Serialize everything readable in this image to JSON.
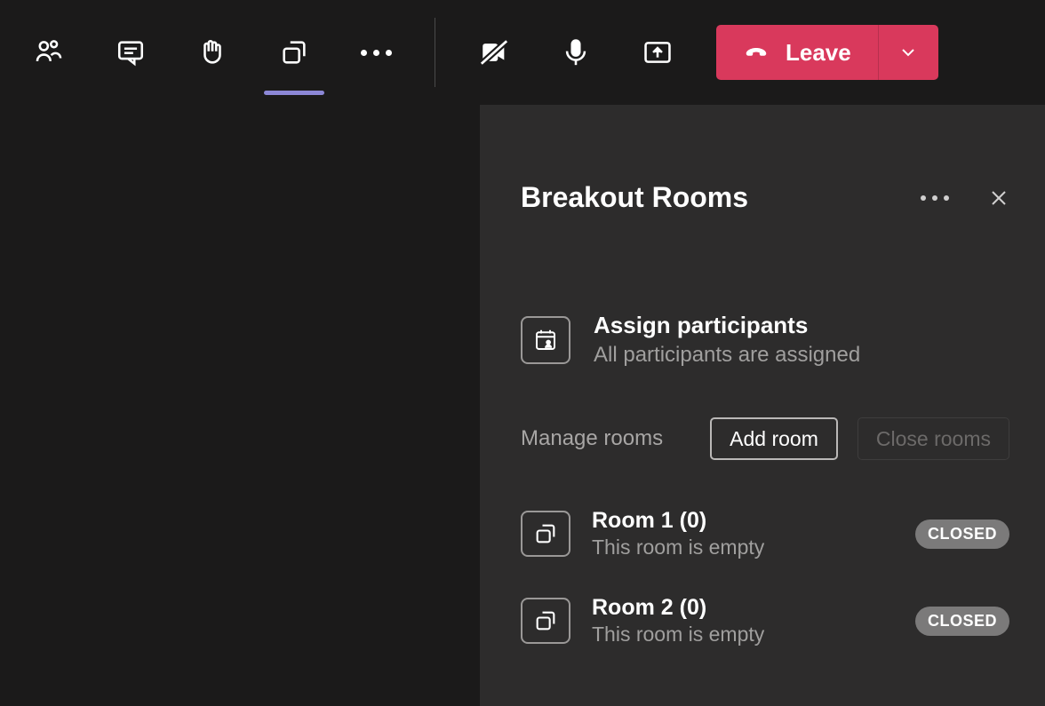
{
  "toolbar": {
    "leave_label": "Leave"
  },
  "panel": {
    "title": "Breakout Rooms",
    "assign": {
      "title": "Assign participants",
      "subtitle": "All participants are assigned"
    },
    "manage_label": "Manage rooms",
    "add_room_label": "Add room",
    "close_rooms_label": "Close rooms"
  },
  "rooms": [
    {
      "title": "Room 1 (0)",
      "subtitle": "This room is empty",
      "status": "CLOSED"
    },
    {
      "title": "Room 2 (0)",
      "subtitle": "This room is empty",
      "status": "CLOSED"
    }
  ]
}
